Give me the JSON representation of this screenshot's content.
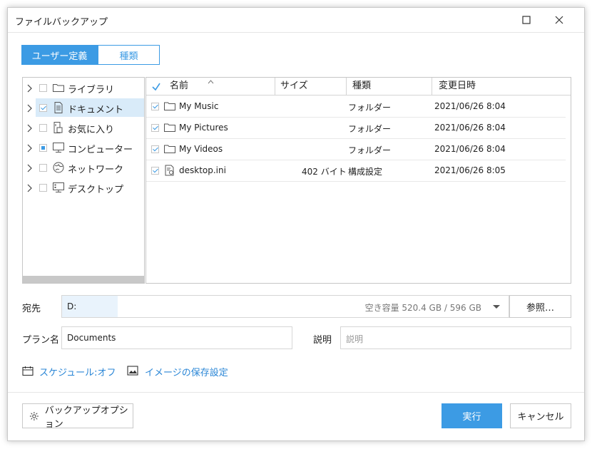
{
  "dialog": {
    "title": "ファイルバックアップ"
  },
  "mode_tabs": [
    {
      "label": "ユーザー定義",
      "active": true
    },
    {
      "label": "種類",
      "active": false
    }
  ],
  "tree": {
    "items": [
      {
        "label": "ライブラリ",
        "checked": "none",
        "icon": "folder-icon"
      },
      {
        "label": "ドキュメント",
        "checked": "checked",
        "icon": "document-icon",
        "selected": true
      },
      {
        "label": "お気に入り",
        "checked": "none",
        "icon": "favorites-icon"
      },
      {
        "label": "コンピューター",
        "checked": "partial",
        "icon": "computer-icon"
      },
      {
        "label": "ネットワーク",
        "checked": "none",
        "icon": "network-icon"
      },
      {
        "label": "デスクトップ",
        "checked": "none",
        "icon": "desktop-icon"
      }
    ]
  },
  "file_list": {
    "columns": [
      "名前",
      "サイズ",
      "種類",
      "変更日時"
    ],
    "rows": [
      {
        "name": "My Music",
        "size": "",
        "type": "フォルダー",
        "modified": "2021/06/26 8:04",
        "icon": "folder-icon"
      },
      {
        "name": "My Pictures",
        "size": "",
        "type": "フォルダー",
        "modified": "2021/06/26 8:04",
        "icon": "folder-icon"
      },
      {
        "name": "My Videos",
        "size": "",
        "type": "フォルダー",
        "modified": "2021/06/26 8:04",
        "icon": "folder-icon"
      },
      {
        "name": "desktop.ini",
        "size": "402 バイト",
        "type": "構成設定",
        "modified": "2021/06/26 8:05",
        "icon": "settings-file-icon"
      }
    ]
  },
  "destination": {
    "label": "宛先",
    "value": "D:",
    "free_space": "空き容量 520.4 GB / 596 GB",
    "browse_label": "参照…"
  },
  "plan": {
    "label": "プラン名",
    "value": "Documents"
  },
  "description": {
    "label": "説明",
    "placeholder": "説明"
  },
  "links": {
    "schedule": "スケジュール:オフ",
    "image_settings": "イメージの保存設定"
  },
  "footer": {
    "options_label": "バックアップオプション",
    "run_label": "実行",
    "cancel_label": "キャンセル"
  },
  "colors": {
    "accent": "#3c9be4",
    "link": "#2a86d6",
    "selection": "#d9ebf9"
  }
}
